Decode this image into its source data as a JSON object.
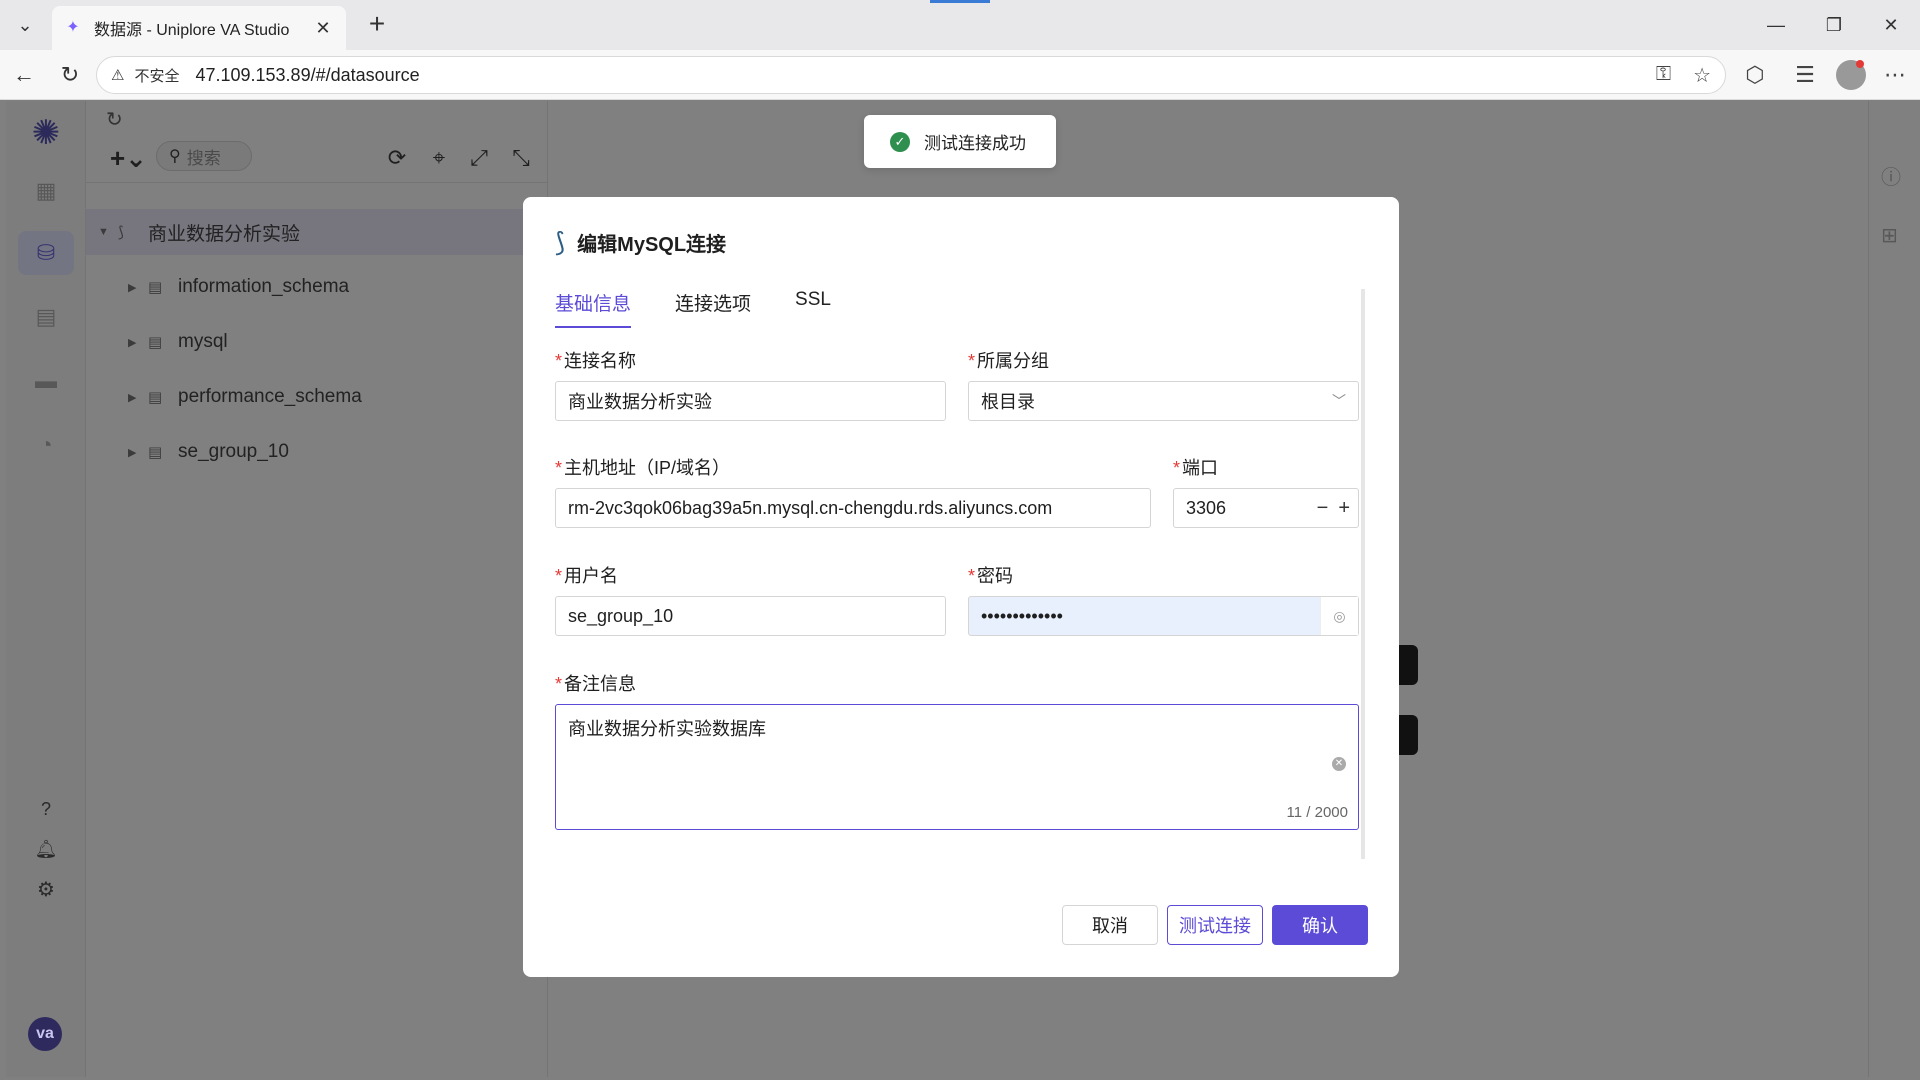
{
  "browser": {
    "tab_title": "数据源 - Uniplore VA Studio",
    "insecure_label": "不安全",
    "url": "47.109.153.89/#/datasource"
  },
  "app": {
    "avatar_text": "va",
    "accent_color": "#5b4bd6"
  },
  "tree": {
    "search_placeholder": "搜索",
    "root": "商业数据分析实验",
    "children": [
      "information_schema",
      "mysql",
      "performance_schema",
      "se_group_10"
    ]
  },
  "toast": {
    "text": "测试连接成功"
  },
  "modal": {
    "title": "编辑MySQL连接",
    "tabs": [
      "基础信息",
      "连接选项",
      "SSL"
    ],
    "fields": {
      "name_label": "连接名称",
      "name_value": "商业数据分析实验",
      "group_label": "所属分组",
      "group_value": "根目录",
      "host_label": "主机地址（IP/域名）",
      "host_value": "rm-2vc3qok06bag39a5n.mysql.cn-chengdu.rds.aliyuncs.com",
      "port_label": "端口",
      "port_value": "3306",
      "user_label": "用户名",
      "user_value": "se_group_10",
      "pwd_label": "密码",
      "pwd_value": "•••••••••••••",
      "note_label": "备注信息",
      "note_value": "商业数据分析实验数据库",
      "note_counter": "11 / 2000"
    },
    "buttons": {
      "cancel": "取消",
      "test": "测试连接",
      "ok": "确认"
    }
  }
}
